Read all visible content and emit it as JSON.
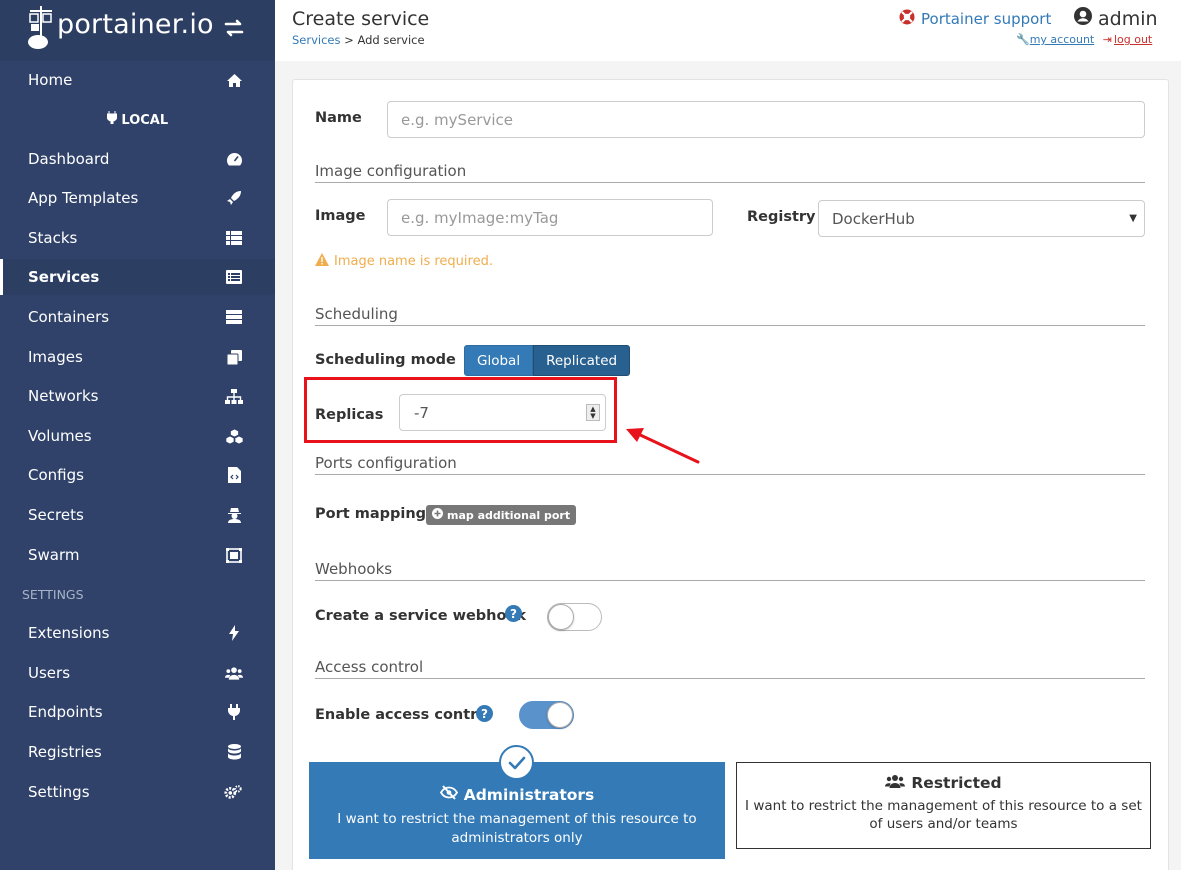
{
  "brand": {
    "name": "portainer.io"
  },
  "sidebar": {
    "home": "Home",
    "endpoint": "LOCAL",
    "items": [
      {
        "label": "Dashboard",
        "icon": "tachometer-icon"
      },
      {
        "label": "App Templates",
        "icon": "rocket-icon"
      },
      {
        "label": "Stacks",
        "icon": "th-list-icon"
      },
      {
        "label": "Services",
        "icon": "list-alt-icon"
      },
      {
        "label": "Containers",
        "icon": "server-icon"
      },
      {
        "label": "Images",
        "icon": "clone-icon"
      },
      {
        "label": "Networks",
        "icon": "sitemap-icon"
      },
      {
        "label": "Volumes",
        "icon": "cubes-icon"
      },
      {
        "label": "Configs",
        "icon": "file-code-icon"
      },
      {
        "label": "Secrets",
        "icon": "user-secret-icon"
      },
      {
        "label": "Swarm",
        "icon": "object-group-icon"
      }
    ],
    "settings_title": "SETTINGS",
    "settings_items": [
      {
        "label": "Extensions",
        "icon": "bolt-icon"
      },
      {
        "label": "Users",
        "icon": "users-icon"
      },
      {
        "label": "Endpoints",
        "icon": "plug-icon"
      },
      {
        "label": "Registries",
        "icon": "database-icon"
      },
      {
        "label": "Settings",
        "icon": "cogs-icon"
      }
    ]
  },
  "header": {
    "title": "Create service",
    "breadcrumb_link": "Services",
    "breadcrumb_current": "> Add service",
    "support": "Portainer support",
    "user": "admin",
    "my_account": "my account",
    "log_out": "log out"
  },
  "form": {
    "name_label": "Name",
    "name_placeholder": "e.g. myService",
    "image_section": "Image configuration",
    "image_label": "Image",
    "image_placeholder": "e.g. myImage:myTag",
    "registry_label": "Registry",
    "registry_value": "DockerHub",
    "image_warning": "Image name is required.",
    "scheduling_section": "Scheduling",
    "scheduling_mode_label": "Scheduling mode",
    "mode_global": "Global",
    "mode_replicated": "Replicated",
    "replicas_label": "Replicas",
    "replicas_value": "-7",
    "ports_section": "Ports configuration",
    "port_mapping_label": "Port mapping",
    "map_port_button": "map additional port",
    "webhooks_section": "Webhooks",
    "webhook_label": "Create a service webhook",
    "webhook_enabled": false,
    "access_section": "Access control",
    "access_label": "Enable access control",
    "access_enabled": true,
    "admin_title": "Administrators",
    "admin_desc": "I want to restrict the management of this resource to administrators only",
    "restricted_title": "Restricted",
    "restricted_desc": "I want to restrict the management of this resource to a set of users and/or teams"
  },
  "colors": {
    "sidebar": "#30426a",
    "primary": "#337ab7",
    "highlight": "#e8121b",
    "warning": "#f0ad4e"
  }
}
